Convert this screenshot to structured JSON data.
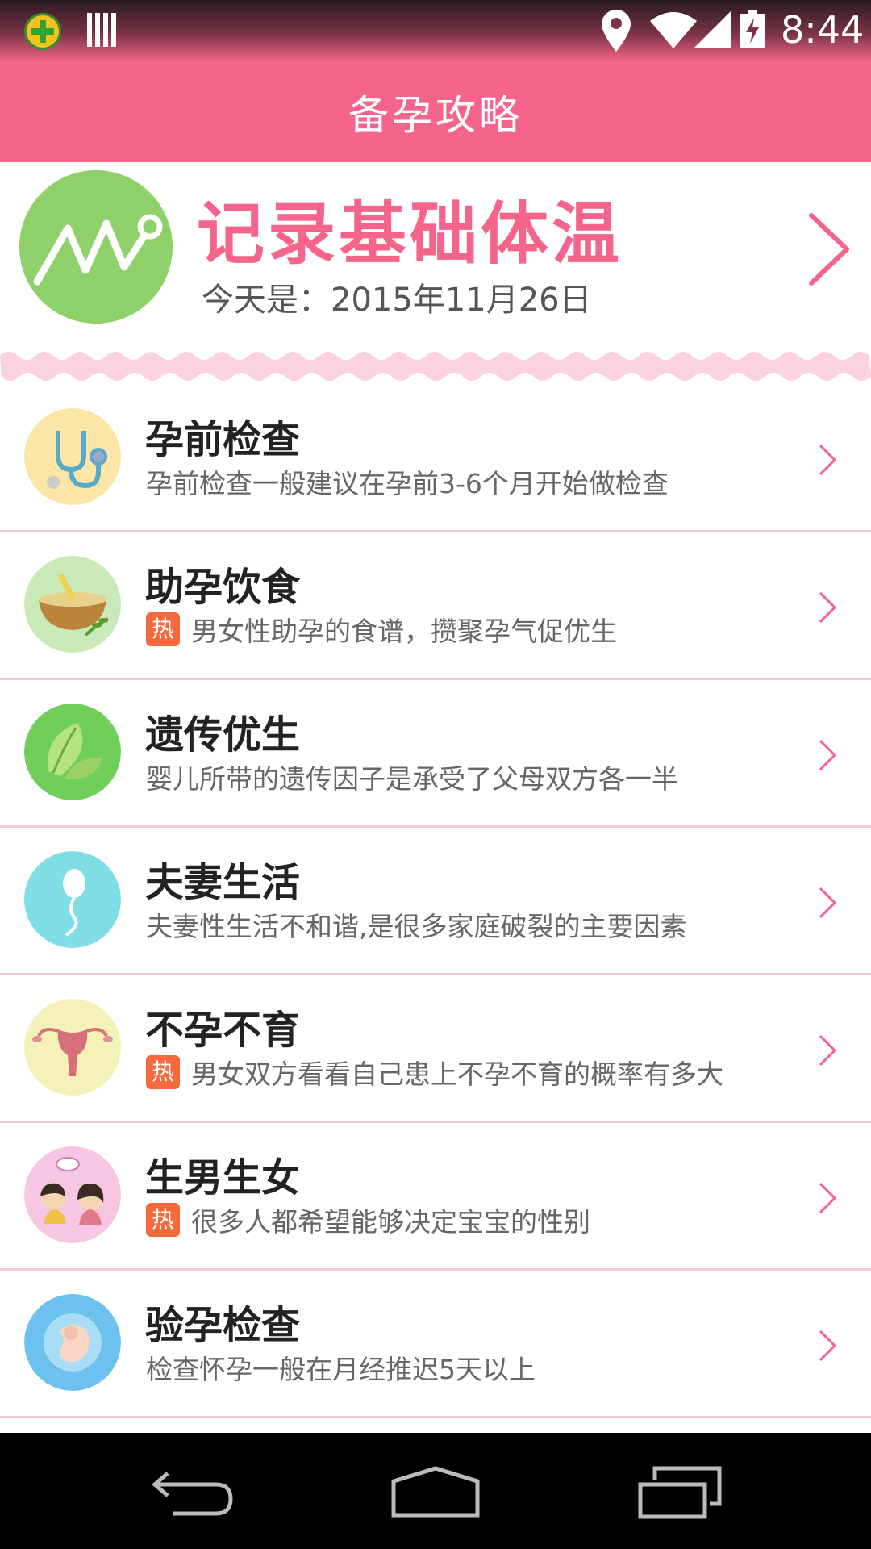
{
  "status_bar": {
    "time": "8:44",
    "icons": [
      "app-icon",
      "barcode-icon",
      "location-icon",
      "wifi-icon",
      "signal-icon",
      "battery-charging-icon"
    ]
  },
  "header": {
    "title": "备孕攻略"
  },
  "temperature_banner": {
    "title": "记录基础体温",
    "date_text": "今天是：2015年11月26日",
    "icon": "chart-line-icon"
  },
  "colors": {
    "accent": "#f5648a",
    "divider": "#f7c7d5",
    "hot_badge": "#f46a3d",
    "banner_icon_bg": "#8ed16a"
  },
  "items": [
    {
      "title": "孕前检查",
      "desc": "孕前检查一般建议在孕前3-6个月开始做检查",
      "hot": false,
      "icon": "stethoscope-icon"
    },
    {
      "title": "助孕饮食",
      "desc": "男女性助孕的食谱，攒聚孕气促优生",
      "hot": true,
      "hot_label": "热",
      "icon": "food-bowl-icon"
    },
    {
      "title": "遗传优生",
      "desc": "婴儿所带的遗传因子是承受了父母双方各一半",
      "hot": false,
      "icon": "leaf-icon"
    },
    {
      "title": "夫妻生活",
      "desc": "夫妻性生活不和谐,是很多家庭破裂的主要因素",
      "hot": false,
      "icon": "sperm-icon"
    },
    {
      "title": "不孕不育",
      "desc": "男女双方看看自己患上不孕不育的概率有多大",
      "hot": true,
      "hot_label": "热",
      "icon": "uterus-icon"
    },
    {
      "title": "生男生女",
      "desc": "很多人都希望能够决定宝宝的性别",
      "hot": true,
      "hot_label": "热",
      "icon": "boy-girl-icon"
    },
    {
      "title": "验孕检查",
      "desc": "检查怀孕一般在月经推迟5天以上",
      "hot": false,
      "icon": "fetus-icon"
    }
  ],
  "nav_bar": {
    "buttons": [
      "back-icon",
      "home-icon",
      "recent-apps-icon"
    ]
  }
}
